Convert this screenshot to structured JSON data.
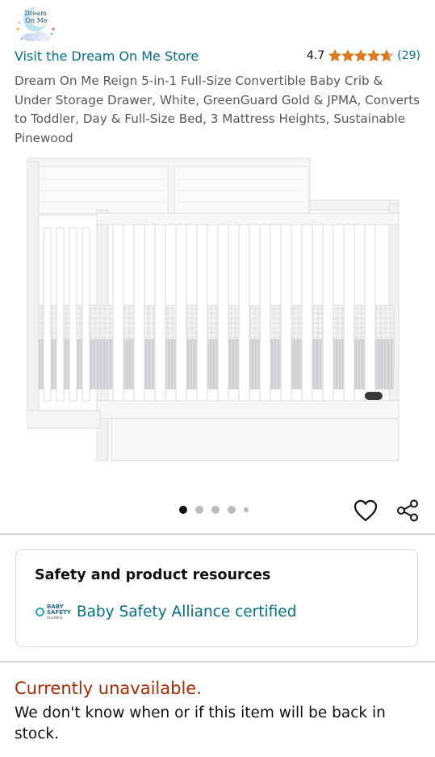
{
  "brand": {
    "logo_text_line1": "Dream",
    "logo_text_line2": "On Me",
    "store_link": "Visit the Dream On Me Store"
  },
  "rating": {
    "value": "4.7",
    "stars": 4.7,
    "count": "(29)",
    "star_color": "#de7921"
  },
  "product": {
    "title": "Dream On Me Reign 5-in-1 Full-Size Convertible Baby Crib & Under Storage Drawer, White, GreenGuard Gold & JPMA, Converts to Toddler, Day & Full-Size Bed, 3 Mattress Heights, Sustainable Pinewood",
    "image_icon": "white-crib-photo"
  },
  "carousel": {
    "count": 5,
    "active_index": 0
  },
  "actions": {
    "wishlist_icon": "heart-icon",
    "share_icon": "share-icon"
  },
  "safety": {
    "heading": "Safety and product resources",
    "badge_line1": "BABY",
    "badge_line2": "SAFETY",
    "badge_line3": "ALLIANCE",
    "certification": "Baby Safety Alliance certified"
  },
  "availability": {
    "status": "Currently unavailable.",
    "message": "We don't know when or if this item will be back in stock.",
    "status_color": "#b12704"
  },
  "colors": {
    "link": "#007185",
    "text": "#0f1111",
    "muted": "#565959"
  }
}
